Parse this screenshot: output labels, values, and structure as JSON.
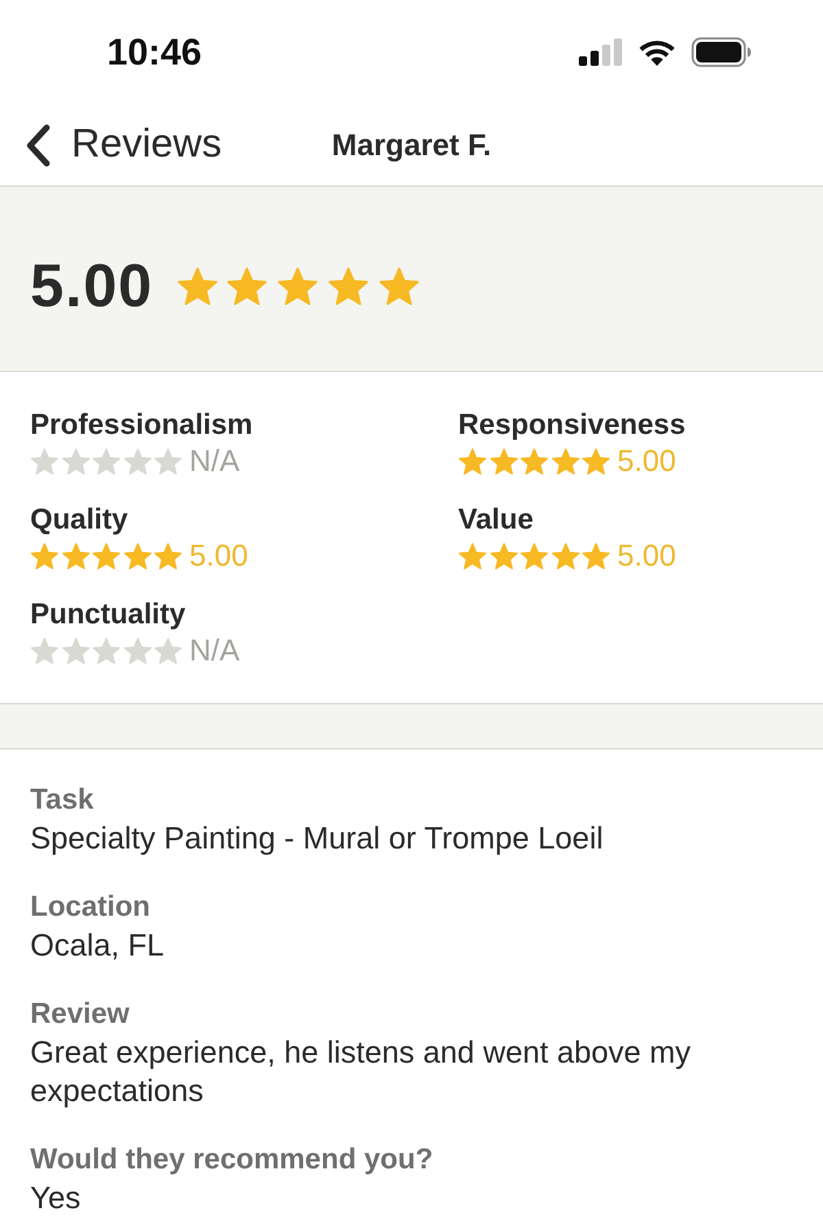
{
  "status_bar": {
    "time": "10:46"
  },
  "nav": {
    "back_label": "Reviews",
    "title": "Margaret F."
  },
  "summary": {
    "score": "5.00",
    "stars": 5
  },
  "categories": [
    {
      "name": "Professionalism",
      "stars": 0,
      "reading": "N/A"
    },
    {
      "name": "Responsiveness",
      "stars": 5,
      "reading": "5.00"
    },
    {
      "name": "Quality",
      "stars": 5,
      "reading": "5.00"
    },
    {
      "name": "Value",
      "stars": 5,
      "reading": "5.00"
    },
    {
      "name": "Punctuality",
      "stars": 0,
      "reading": "N/A"
    }
  ],
  "details": [
    {
      "label": "Task",
      "value": "Specialty Painting - Mural or Trompe Loeil"
    },
    {
      "label": "Location",
      "value": "Ocala, FL"
    },
    {
      "label": "Review",
      "value": "Great experience, he listens and went above my expectations"
    },
    {
      "label": "Would they recommend you?",
      "value": "Yes"
    }
  ]
}
